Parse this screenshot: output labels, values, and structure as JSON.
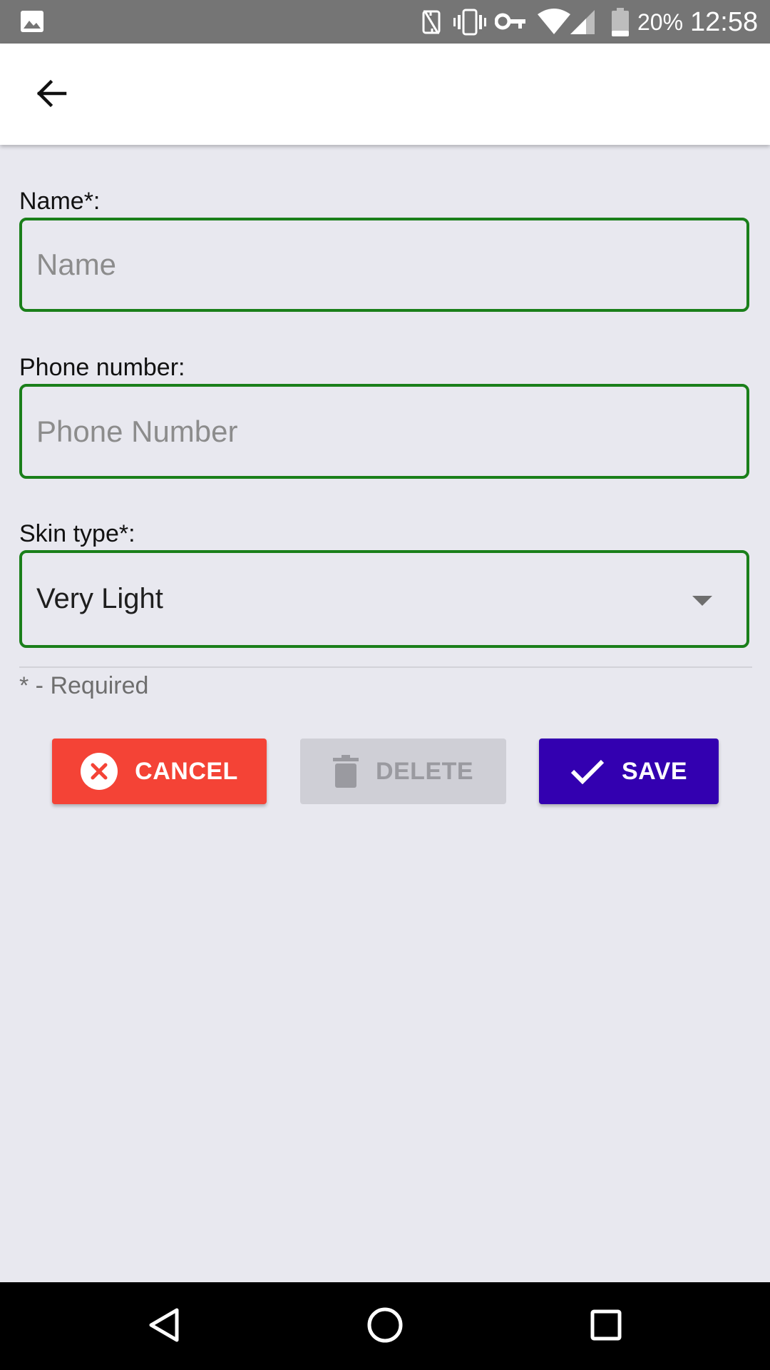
{
  "status_bar": {
    "battery_text": "20%",
    "clock_text": "12:58",
    "icons": [
      "gallery-icon",
      "nfc-icon",
      "vibrate-icon",
      "key-icon",
      "wifi-icon",
      "signal-icon",
      "battery-icon"
    ]
  },
  "app_bar": {
    "back_icon": "arrow-back-icon"
  },
  "form": {
    "name": {
      "label": "Name*:",
      "placeholder": "Name",
      "value": ""
    },
    "phone": {
      "label": "Phone number:",
      "placeholder": "Phone Number",
      "value": ""
    },
    "skin_type": {
      "label": "Skin type*:",
      "selected": "Very Light"
    },
    "required_note": "* - Required",
    "border_color": "#1a7f1a"
  },
  "buttons": {
    "cancel": {
      "label": "CANCEL",
      "icon": "cancel-circle-icon",
      "color": "#f44336"
    },
    "delete": {
      "label": "DELETE",
      "icon": "trash-icon",
      "color": "#cfcfd6",
      "disabled": true
    },
    "save": {
      "label": "SAVE",
      "icon": "check-icon",
      "color": "#3300b0"
    }
  },
  "nav_bar": {
    "icons": [
      "back-triangle-icon",
      "home-circle-icon",
      "recents-square-icon"
    ]
  }
}
